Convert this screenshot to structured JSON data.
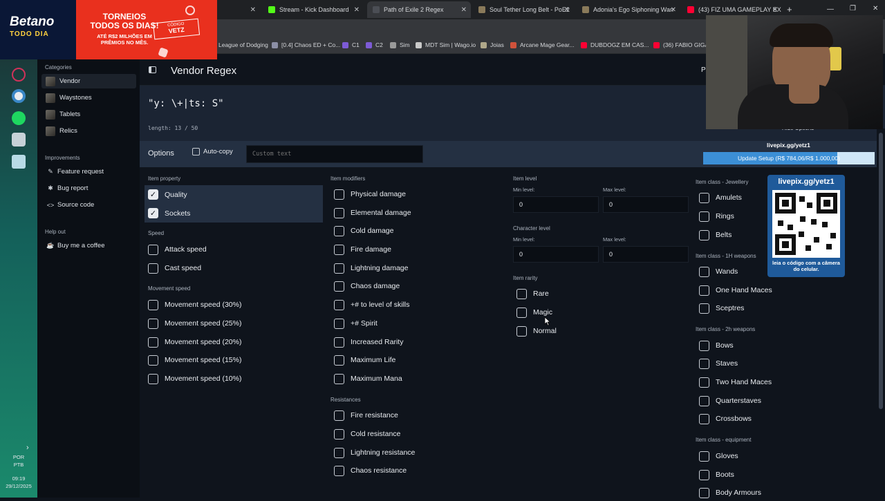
{
  "browser": {
    "tabs": [
      {
        "label": "Stream - Kick Dashboard",
        "active": false
      },
      {
        "label": "Path of Exile 2 Regex",
        "active": true
      },
      {
        "label": "Soul Tether Long Belt - PoE2",
        "active": false
      },
      {
        "label": "Adonia's Ego Siphoning Wan",
        "active": false
      },
      {
        "label": "(43) FIZ UMA GAMEPLAY EX",
        "active": false
      }
    ],
    "new_tab": "+",
    "bookmarks": [
      "League of Dodging",
      "[0.4] Chaos ED + Co...",
      "C1",
      "C2",
      "Sim",
      "MDT Sim | Wago.io",
      "Joias",
      "Arcane Mage Gear...",
      "DUBDOGZ EM CAS...",
      "(36) FABIO GIGA S"
    ]
  },
  "promo": {
    "brand": "Betano",
    "brand_sub": "TODO DIA",
    "headline": "TORNEIOS TODOS OS DIAS!",
    "subline": "ATÉ R$2 MILHÕES EM PRÊMIOS NO MÊS.",
    "code_label": "CÓDIGO",
    "code": "VETZ"
  },
  "sidebar": {
    "categories_label": "Categories",
    "categories": [
      "Vendor",
      "Waystones",
      "Tablets",
      "Relics"
    ],
    "improvements_label": "Improvements",
    "improvements": [
      {
        "icon": "pencil-icon",
        "label": "Feature request"
      },
      {
        "icon": "bug-icon",
        "label": "Bug report"
      },
      {
        "icon": "code-icon",
        "label": "Source code"
      }
    ],
    "helpout_label": "Help out",
    "helpout": [
      {
        "icon": "coffee-icon",
        "label": "Buy me a coffee"
      }
    ]
  },
  "taskbar": {
    "lang1": "POR",
    "lang2": "PTB",
    "time": "09:19",
    "date": "29/12/2025"
  },
  "header": {
    "title": "Vendor Regex",
    "partial_right": "P"
  },
  "regex": {
    "value": "\"y: \\+|ts: S\"",
    "length_text": "length: 13 / 50"
  },
  "options": {
    "label": "Options",
    "autocopy_label": "Auto-copy",
    "custom_placeholder": "Custom text",
    "hide_options": "Hide Options"
  },
  "item_property": {
    "label": "Item property",
    "items": [
      {
        "label": "Quality",
        "checked": true
      },
      {
        "label": "Sockets",
        "checked": true
      }
    ]
  },
  "speed": {
    "label": "Speed",
    "items": [
      {
        "label": "Attack speed",
        "checked": false
      },
      {
        "label": "Cast speed",
        "checked": false
      }
    ]
  },
  "movement_speed": {
    "label": "Movement speed",
    "items": [
      {
        "label": "Movement speed (30%)",
        "checked": false
      },
      {
        "label": "Movement speed (25%)",
        "checked": false
      },
      {
        "label": "Movement speed (20%)",
        "checked": false
      },
      {
        "label": "Movement speed (15%)",
        "checked": false
      },
      {
        "label": "Movement speed (10%)",
        "checked": false
      }
    ]
  },
  "item_modifiers": {
    "label": "Item modifiers",
    "items": [
      {
        "label": "Physical damage",
        "checked": false
      },
      {
        "label": "Elemental damage",
        "checked": false
      },
      {
        "label": "Cold damage",
        "checked": false
      },
      {
        "label": "Fire damage",
        "checked": false
      },
      {
        "label": "Lightning damage",
        "checked": false
      },
      {
        "label": "Chaos damage",
        "checked": false
      },
      {
        "label": "+# to level of skills",
        "checked": false
      },
      {
        "label": "+# Spirit",
        "checked": false
      },
      {
        "label": "Increased Rarity",
        "checked": false
      },
      {
        "label": "Maximum Life",
        "checked": false
      },
      {
        "label": "Maximum Mana",
        "checked": false
      }
    ]
  },
  "resistances": {
    "label": "Resistances",
    "items": [
      {
        "label": "Fire resistance",
        "checked": false
      },
      {
        "label": "Cold resistance",
        "checked": false
      },
      {
        "label": "Lightning resistance",
        "checked": false
      },
      {
        "label": "Chaos resistance",
        "checked": false
      }
    ]
  },
  "item_level": {
    "label": "Item level",
    "min_label": "Min level:",
    "max_label": "Max level:",
    "min_value": "0",
    "max_value": "0"
  },
  "character_level": {
    "label": "Character level",
    "min_label": "Min level:",
    "max_label": "Max level:",
    "min_value": "0",
    "max_value": "0"
  },
  "item_rarity": {
    "label": "Item rarity",
    "items": [
      {
        "label": "Rare",
        "checked": false
      },
      {
        "label": "Magic",
        "checked": false
      },
      {
        "label": "Normal",
        "checked": false
      }
    ]
  },
  "class_jewellery": {
    "label": "Item class - Jewellery",
    "items": [
      {
        "label": "Amulets",
        "checked": false
      },
      {
        "label": "Rings",
        "checked": false
      },
      {
        "label": "Belts",
        "checked": false
      }
    ]
  },
  "class_1h": {
    "label": "Item class - 1H weapons",
    "items": [
      {
        "label": "Wands",
        "checked": false
      },
      {
        "label": "One Hand Maces",
        "checked": false
      },
      {
        "label": "Sceptres",
        "checked": false
      }
    ]
  },
  "class_2h": {
    "label": "Item class - 2h weapons",
    "items": [
      {
        "label": "Bows",
        "checked": false
      },
      {
        "label": "Staves",
        "checked": false
      },
      {
        "label": "Two Hand Maces",
        "checked": false
      },
      {
        "label": "Quarterstaves",
        "checked": false
      },
      {
        "label": "Crossbows",
        "checked": false
      }
    ]
  },
  "class_equipment": {
    "label": "Item class - equipment",
    "items": [
      {
        "label": "Gloves",
        "checked": false
      },
      {
        "label": "Boots",
        "checked": false
      },
      {
        "label": "Body Armours",
        "checked": false
      }
    ]
  },
  "overlay": {
    "livepix_url": "livepix.gg/yetz1",
    "progress_text": "Update Setup (R$ 784,06/R$ 1.000,00)",
    "progress_fraction": 0.784,
    "qr_title": "livepix.gg/yetz1",
    "qr_caption": "leia o código com a câmera do celular."
  }
}
